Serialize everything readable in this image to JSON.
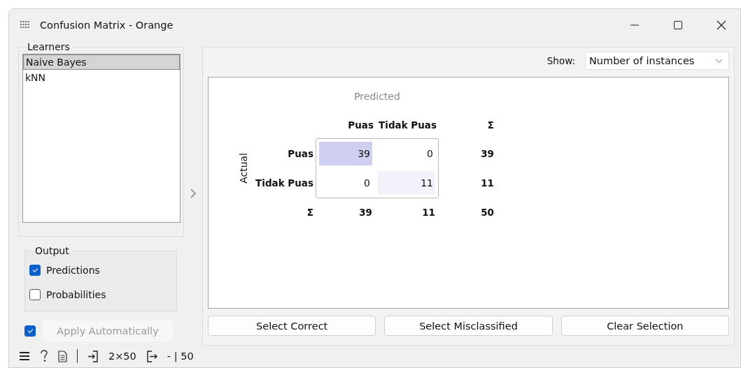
{
  "window": {
    "title": "Confusion Matrix - Orange"
  },
  "learners": {
    "title": "Learners",
    "items": [
      {
        "label": "Naive Bayes",
        "selected": true
      },
      {
        "label": "kNN",
        "selected": false
      }
    ]
  },
  "output": {
    "title": "Output",
    "options": [
      {
        "label": "Predictions",
        "checked": true
      },
      {
        "label": "Probabilities",
        "checked": false
      }
    ]
  },
  "apply": {
    "checked": true,
    "label": "Apply Automatically",
    "disabled": true
  },
  "show": {
    "label": "Show:",
    "value": "Number of instances"
  },
  "matrix": {
    "predicted_label": "Predicted",
    "actual_label": "Actual",
    "columns": [
      "Puas",
      "Tidak Puas"
    ],
    "column_sum_symbol": "Σ",
    "row_sum_symbol": "Σ",
    "rows": [
      {
        "label": "Puas",
        "values": [
          "39",
          "0"
        ],
        "total": "39"
      },
      {
        "label": "Tidak Puas",
        "values": [
          "0",
          "11"
        ],
        "total": "11"
      }
    ],
    "column_totals": [
      "39",
      "11"
    ],
    "grand_total": "50"
  },
  "buttons": [
    "Select Correct",
    "Select Misclassified",
    "Clear Selection"
  ],
  "status_bar": {
    "input": "2×50",
    "output": "- | 50"
  }
}
